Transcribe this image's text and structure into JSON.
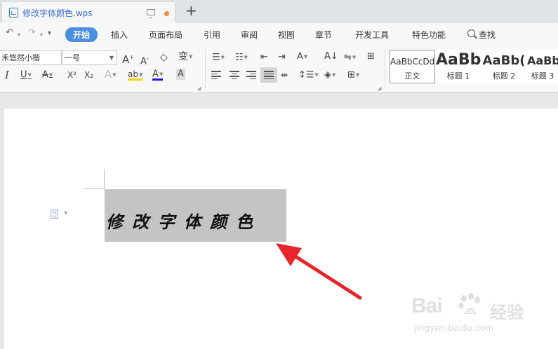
{
  "tab": {
    "doc_name": "修改字体颜色.wps",
    "new_tab_label": "+"
  },
  "quick_access": {
    "undo": "↶",
    "redo": "↷",
    "dropdown": "▾"
  },
  "menu": {
    "items": [
      "开始",
      "插入",
      "页面布局",
      "引用",
      "审阅",
      "视图",
      "章节",
      "开发工具",
      "特色功能",
      "查找"
    ],
    "active_index": 0
  },
  "ribbon": {
    "font_name": "禾悠然小楷",
    "font_size": "一号",
    "grow_font": "A",
    "shrink_font": "A",
    "clear_format": "◇",
    "phonetic": "变",
    "italic": "I",
    "underline": "U",
    "strikethrough": "A",
    "superscript": "X²",
    "subscript": "X₂",
    "text_effect": "A",
    "highlight": "ab",
    "font_color": "A",
    "char_shading": "A",
    "sort": "A↓",
    "highlight_color": "#f4d000",
    "font_color_swatch": "#1a1ad0"
  },
  "styles": [
    {
      "preview": "AaBbCcDd",
      "name": "正文"
    },
    {
      "preview": "AaBb",
      "name": "标题 1"
    },
    {
      "preview": "AaBb(",
      "name": "标题 2"
    },
    {
      "preview": "AaBb",
      "name": "标题 3"
    }
  ],
  "document": {
    "selected_text": "修改字体颜色"
  },
  "watermark": {
    "brand": "Bai",
    "brand_after": "du",
    "cn": "经验",
    "url": "jingyan.baidu.com"
  },
  "colors": {
    "accent": "#4b8fe0",
    "arrow": "#e8252a",
    "selection": "#c4c4c4",
    "tab_dot": "#f08a3c"
  }
}
